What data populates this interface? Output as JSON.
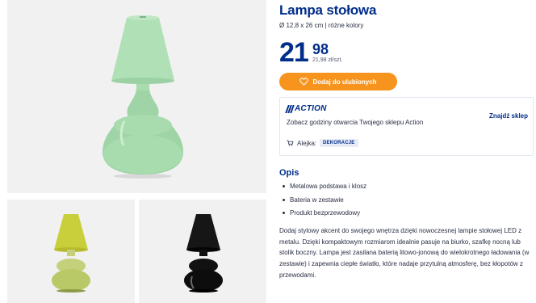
{
  "product": {
    "title": "Lampa stołowa",
    "subtitle": "Ø 12,8 x 26 cm | różne kolory",
    "price_integer": "21",
    "price_decimal": "98",
    "unit_price": "21,98 zł/szt.",
    "favorite_button_label": "Dodaj do ulubionych"
  },
  "gallery": {
    "main_color": "#a8dcae",
    "thumbs": [
      {
        "color": "#c9cf3a"
      },
      {
        "color": "#111111"
      }
    ]
  },
  "store": {
    "logo_text": "ACTION",
    "opening_hours_text": "Zobacz godziny otwarcia Twojego sklepu Action",
    "find_store_link": "Znajdź sklep",
    "aisle_label": "Alejka:",
    "aisle_badge": "DEKORACJE"
  },
  "description": {
    "heading": "Opis",
    "bullets": [
      "Metalowa podstawa i klosz",
      "Bateria w zestawie",
      "Produkt bezprzewodowy"
    ],
    "body": "Dodaj stylowy akcent do swojego wnętrza dzięki nowoczesnej lampie stołowej LED z metalu. Dzięki kompaktowym rozmiarom idealnie pasuje na biurko, szafkę nocną lub stolik boczny. Lampa jest zasilana baterią litowo-jonową do wielokrotnego ładowania (w zestawie) i zapewnia ciepłe światło, które nadaje przytulną atmosferę, bez kłopotów z przewodami."
  },
  "colors": {
    "brand_blue": "#002e8a",
    "accent_orange": "#f7941d"
  },
  "icons": {
    "favorite": "heart-icon",
    "aisle": "cart-icon"
  }
}
